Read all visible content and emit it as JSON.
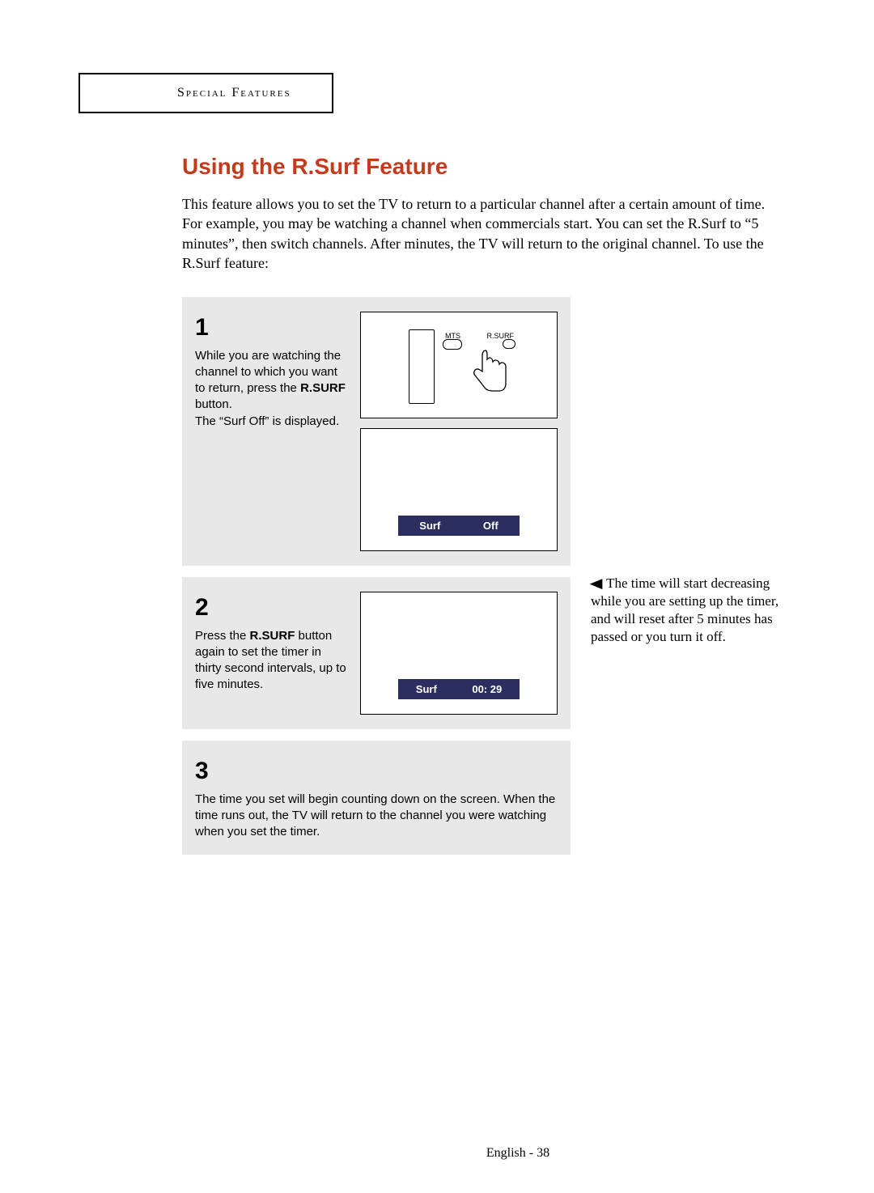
{
  "section_label": "Special Features",
  "title": "Using the R.Surf Feature",
  "intro": "This feature allows you to set the TV to return to a particular channel after a certain amount of time. For example, you may be watching a channel when commercials start. You can set the R.Surf to “5 minutes”, then switch channels. After minutes, the TV will return to the original channel. To use the R.Surf feature:",
  "steps": {
    "s1": {
      "num": "1",
      "text_a": "While you are watching the channel to which you want to return, press the ",
      "bold": "R.SURF",
      "text_b": " button.",
      "text_c": "The “Surf Off” is displayed.",
      "remote": {
        "mts": "MTS",
        "rsurf": "R.SURF"
      },
      "osd": {
        "label": "Surf",
        "value": "Off"
      }
    },
    "s2": {
      "num": "2",
      "text_a": "Press the ",
      "bold": "R.SURF",
      "text_b": " button again to set the timer in thirty second intervals, up to five minutes.",
      "osd": {
        "label": "Surf",
        "value": "00:  29"
      }
    },
    "s3": {
      "num": "3",
      "text": "The time you set will begin counting down on the screen. When the time runs out, the TV will return to the channel you were watching when you set the timer."
    }
  },
  "side_note": "The time will start decreasing while you are setting up the timer, and will reset after 5 minutes has passed or you turn it off.",
  "footer": "English - 38"
}
